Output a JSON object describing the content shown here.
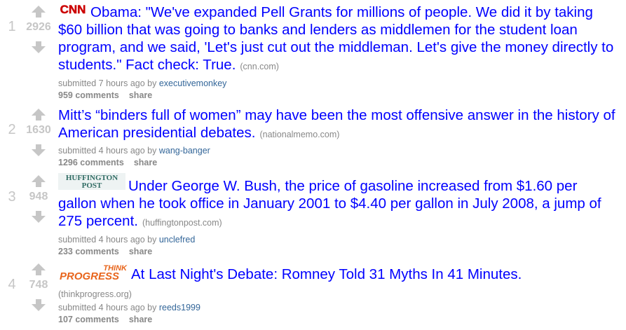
{
  "posts": [
    {
      "rank": "1",
      "score": "2926",
      "logo": "cnn-logo",
      "logo_text": "CNN",
      "title": "Obama: \"We've expanded Pell Grants for millions of people. We did it by taking $60 billion that was going to banks and lenders as middlemen for the student loan program, and we said, 'Let's just cut out the middleman. Let's give the money directly to students.\" Fact check: True.",
      "domain": "(cnn.com)",
      "submitted": "submitted 7 hours ago by",
      "author": "executivemonkey",
      "comments": "959 comments",
      "share": "share"
    },
    {
      "rank": "2",
      "score": "1630",
      "logo": "",
      "title": "Mitt’s “binders full of women” may have been the most offensive answer in the history of American presidential debates.",
      "domain": "(nationalmemo.com)",
      "submitted": "submitted 4 hours ago by",
      "author": "wang-banger",
      "comments": "1296 comments",
      "share": "share"
    },
    {
      "rank": "3",
      "score": "948",
      "logo": "huffington-post-logo",
      "logo_text_1": "HUFFINGTON",
      "logo_text_2": "POST",
      "title": "Under George W. Bush, the price of gasoline increased from $1.60 per gallon when he took office in January 2001 to $4.40 per gallon in July 2008, a jump of 275 percent.",
      "domain": "(huffingtonpost.com)",
      "submitted": "submitted 4 hours ago by",
      "author": "unclefred",
      "comments": "233 comments",
      "share": "share"
    },
    {
      "rank": "4",
      "score": "748",
      "logo": "think-progress-logo",
      "logo_text_1": "THINK",
      "logo_text_2": "PROGRESS",
      "title": "At Last Night's Debate: Romney Told 31 Myths In 41 Minutes.",
      "domain": "(thinkprogress.org)",
      "submitted": "submitted 4 hours ago by",
      "author": "reeds1999",
      "comments": "107 comments",
      "share": "share"
    }
  ]
}
